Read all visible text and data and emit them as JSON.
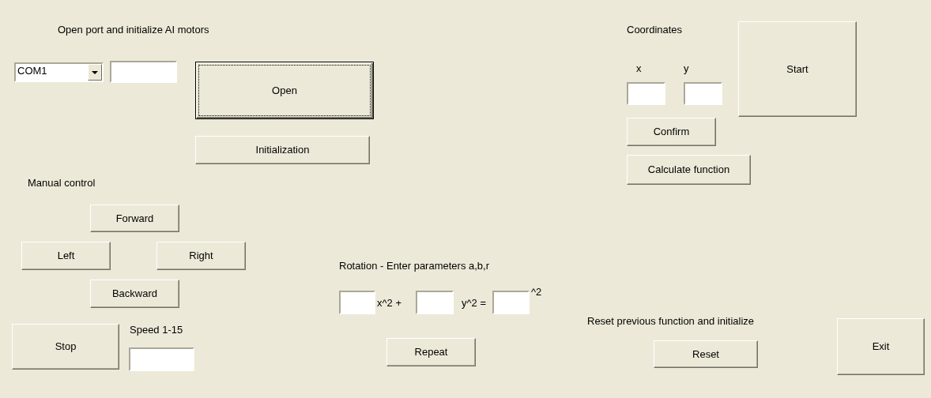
{
  "controls": [
    {
      "kind": "label",
      "text": "Open port and initialize AI motors"
    },
    {
      "kind": "combo",
      "value": "COM1"
    },
    {
      "kind": "field"
    },
    {
      "kind": "button",
      "text": "Open",
      "focused": true
    },
    {
      "kind": "button",
      "text": "Initialization",
      "focused": false
    },
    {
      "kind": "label",
      "text": "Manual control"
    },
    {
      "kind": "button",
      "text": "Forward",
      "focused": false
    },
    {
      "kind": "button",
      "text": "Left",
      "focused": false
    },
    {
      "kind": "button",
      "text": "Right",
      "focused": false
    },
    {
      "kind": "button",
      "text": "Backward",
      "focused": false
    },
    {
      "kind": "button",
      "text": "Stop",
      "focused": false
    },
    {
      "kind": "label",
      "text": "Speed 1-15"
    },
    {
      "kind": "field"
    },
    {
      "kind": "label",
      "text": "Coordinates"
    },
    {
      "kind": "label",
      "text": "x"
    },
    {
      "kind": "label",
      "text": "y"
    },
    {
      "kind": "field"
    },
    {
      "kind": "field"
    },
    {
      "kind": "button",
      "text": "Start",
      "focused": false
    },
    {
      "kind": "button",
      "text": "Confirm",
      "focused": false
    },
    {
      "kind": "button",
      "text": "Calculate function",
      "focused": false
    },
    {
      "kind": "label",
      "text": "Rotation - Enter parameters a,b,r"
    },
    {
      "kind": "field"
    },
    {
      "kind": "label",
      "text": "x^2 +"
    },
    {
      "kind": "field"
    },
    {
      "kind": "label",
      "text": "y^2 ="
    },
    {
      "kind": "field"
    },
    {
      "kind": "label",
      "text": "^2"
    },
    {
      "kind": "button",
      "text": "Repeat",
      "focused": false
    },
    {
      "kind": "label",
      "text": "Reset previous function and initialize"
    },
    {
      "kind": "button",
      "text": "Reset",
      "focused": false
    },
    {
      "kind": "button",
      "text": "Exit",
      "focused": false
    }
  ]
}
